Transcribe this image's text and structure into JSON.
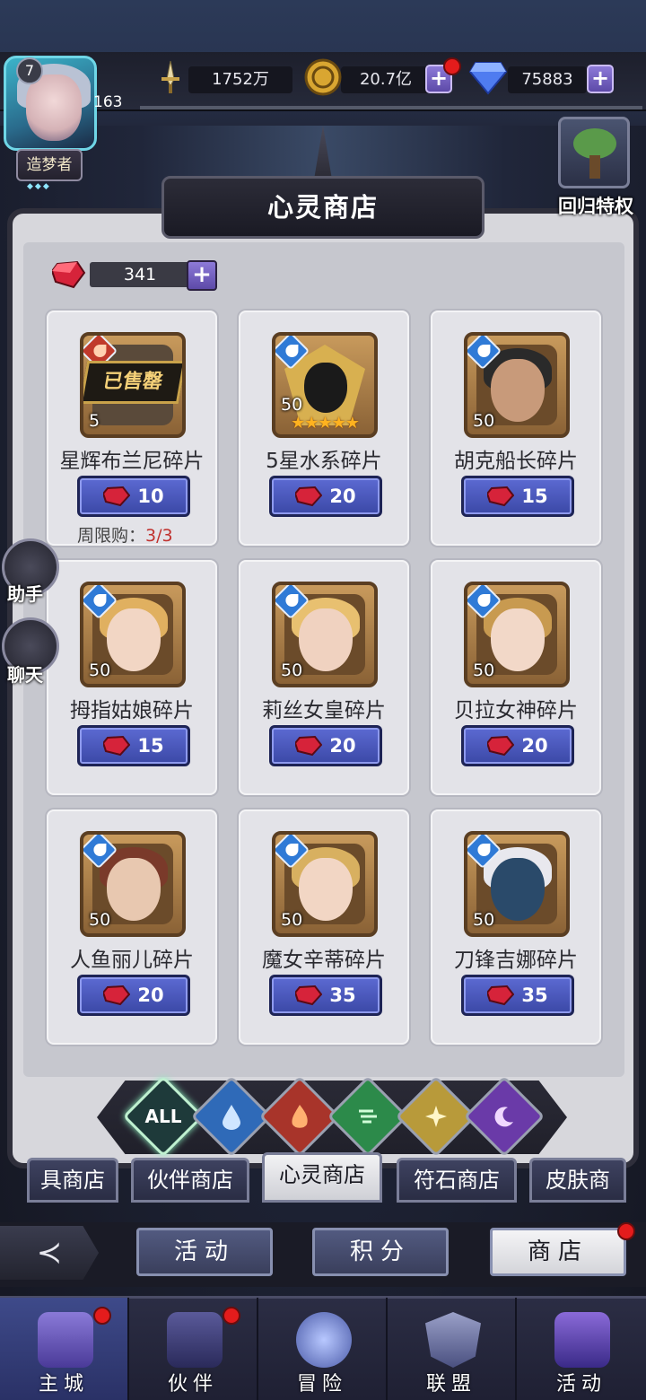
{
  "player": {
    "level": "7",
    "sub_level": "163",
    "title": "造梦者",
    "title_stars": "◆◆◆"
  },
  "resources": {
    "power": "1752万",
    "gold": "20.7亿",
    "diamonds": "75883"
  },
  "return_privilege": {
    "label": "回归特权"
  },
  "shop": {
    "title": "心灵商店",
    "currency_amount": "341",
    "items": [
      {
        "name": "星辉布兰尼碎片",
        "price": "10",
        "count": "5",
        "sold_out": "已售罄",
        "limit_label": "周限购：",
        "limit_value": "3/3",
        "element": "fire"
      },
      {
        "name": "5星水系碎片",
        "price": "20",
        "count": "50",
        "stars": "★★★★★",
        "element": "water"
      },
      {
        "name": "胡克船长碎片",
        "price": "15",
        "count": "50",
        "element": "water"
      },
      {
        "name": "拇指姑娘碎片",
        "price": "15",
        "count": "50",
        "element": "water"
      },
      {
        "name": "莉丝女皇碎片",
        "price": "20",
        "count": "50",
        "element": "water"
      },
      {
        "name": "贝拉女神碎片",
        "price": "20",
        "count": "50",
        "element": "water"
      },
      {
        "name": "人鱼丽儿碎片",
        "price": "20",
        "count": "50",
        "element": "water"
      },
      {
        "name": "魔女辛蒂碎片",
        "price": "35",
        "count": "50",
        "element": "water"
      },
      {
        "name": "刀锋吉娜碎片",
        "price": "35",
        "count": "50",
        "element": "water"
      }
    ],
    "filters": {
      "all_label": "ALL"
    },
    "tabs": [
      "具商店",
      "伙伴商店",
      "心灵商店",
      "符石商店",
      "皮肤商"
    ]
  },
  "subnav": {
    "activity": "活动",
    "points": "积分",
    "shop": "商店"
  },
  "bottom_nav": [
    "主城",
    "伙伴",
    "冒险",
    "联盟",
    "活动"
  ],
  "side": {
    "assistant": "助手",
    "chat": "聊天"
  },
  "colors": {
    "price_button": "#4b58bc",
    "limit_red": "#c0312e",
    "plus_purple": "#7462c0",
    "alert_red": "#e41c1c"
  }
}
